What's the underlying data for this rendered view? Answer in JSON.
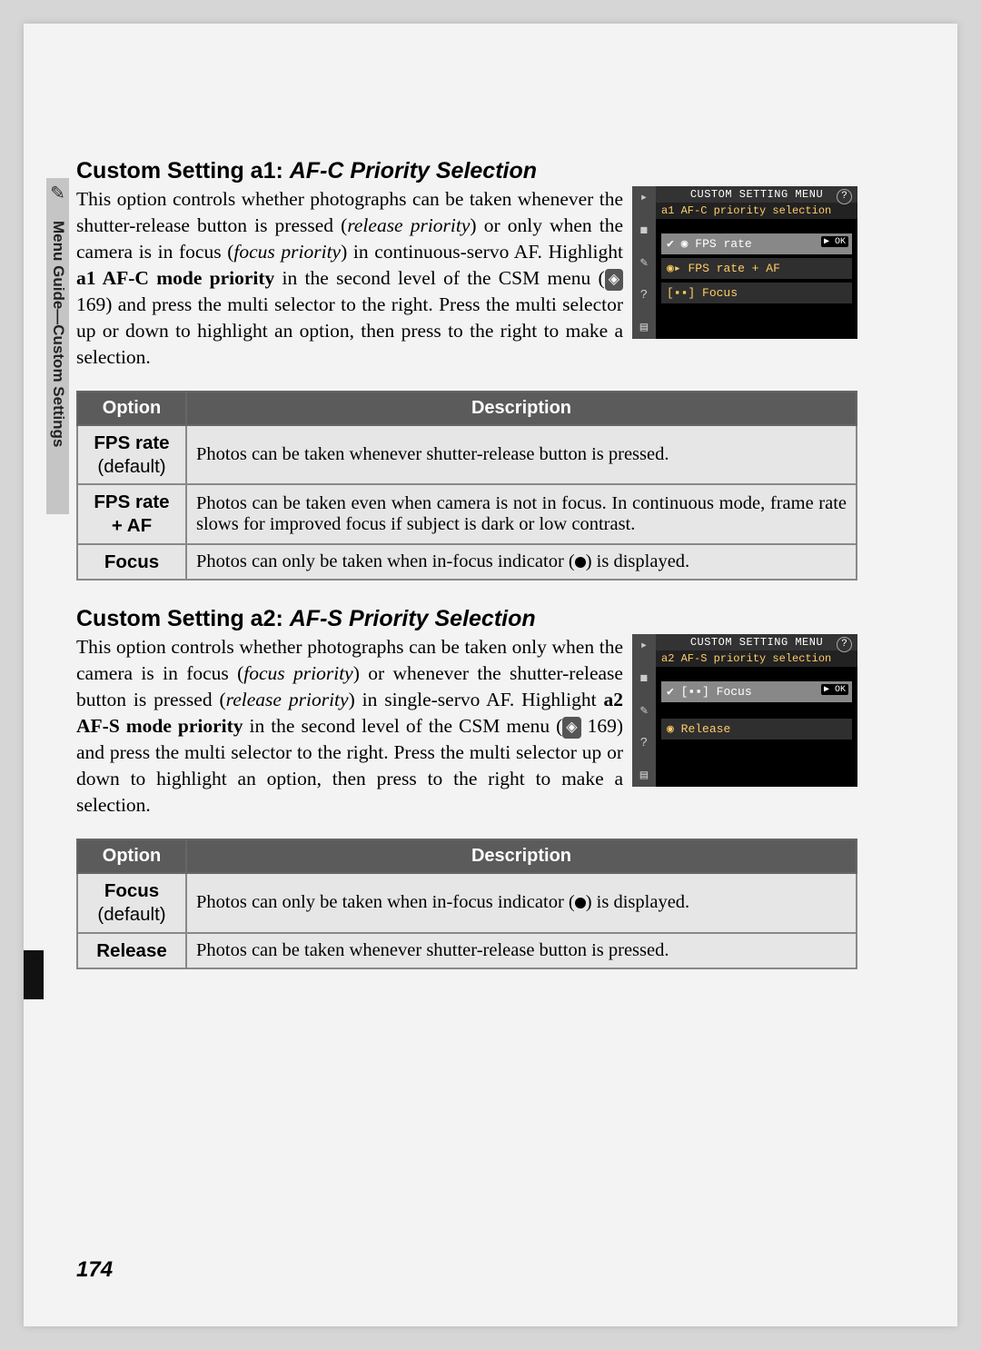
{
  "sideLabel": "Menu Guide—Custom Settings",
  "pageNumber": "174",
  "pageRef": "169",
  "a1": {
    "heading": "Custom Setting a1:",
    "headingItalic": "AF-C Priority Selection",
    "screenshot": {
      "title": "CUSTOM SETTING MENU",
      "sub": "a1  AF-C priority selection",
      "rows": [
        "FPS rate",
        "FPS rate + AF",
        "Focus"
      ],
      "selectedIndex": 0,
      "ok": "OK"
    },
    "table": {
      "headOption": "Option",
      "headDesc": "Description",
      "rows": [
        {
          "opt": "FPS rate",
          "sub": "(default)",
          "desc": "Photos can be taken whenever shutter-release button is pressed."
        },
        {
          "opt": "FPS rate + AF",
          "sub": "",
          "desc": "Photos can be taken even when camera is not in focus. In continuous mode, frame rate slows for improved focus if subject is dark or low contrast."
        },
        {
          "opt": "Focus",
          "sub": "",
          "desc": "Photos can only be taken when in-focus indicator (●) is displayed."
        }
      ]
    }
  },
  "a2": {
    "heading": "Custom Setting a2:",
    "headingItalic": "AF-S Priority Selection",
    "screenshot": {
      "title": "CUSTOM SETTING MENU",
      "sub": "a2  AF-S priority selection",
      "rows": [
        "Focus",
        "Release"
      ],
      "selectedIndex": 0,
      "ok": "OK"
    },
    "table": {
      "headOption": "Option",
      "headDesc": "Description",
      "rows": [
        {
          "opt": "Focus",
          "sub": "(default)",
          "desc": "Photos can only be taken when in-focus indicator (●) is displayed."
        },
        {
          "opt": "Release",
          "sub": "",
          "desc": "Photos can be taken whenever shutter-release button is pressed."
        }
      ]
    }
  }
}
